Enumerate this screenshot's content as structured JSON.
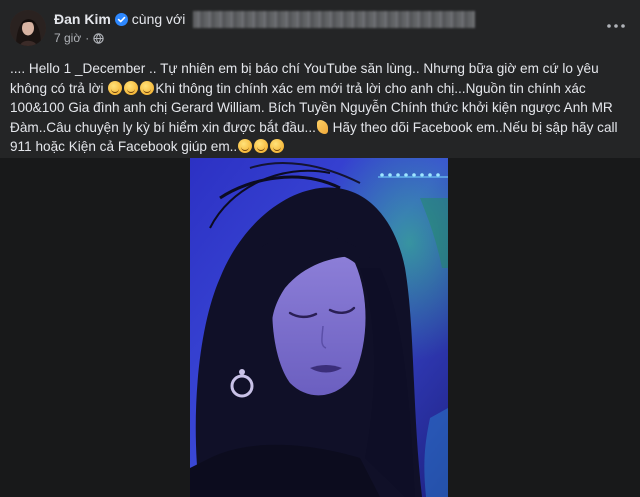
{
  "header": {
    "author": "Đan Kim",
    "with_text": "cùng với",
    "time": "7 giờ",
    "separator": "·",
    "icons": {
      "verified": "verified-badge-icon",
      "audience": "globe-icon",
      "more": "more-options-icon"
    },
    "accent_color": "#2d88ff"
  },
  "post": {
    "segments": [
      ".... Hello 1 _December .. Tự nhiên em bị báo chí YouTube săn lùng.. Nhưng bữa giờ em cứ lo yêu không có trả lời ",
      "Khi thông tin chính xác em mới trả lời cho anh chị...Nguồn tin chính xác 100&100 Gia đình anh chị Gerard William. Bích Tuyền Nguyễn Chính thức khởi kiện ngược Anh MR Đàm..Câu chuyện ly kỳ bí hiểm xin được bắt đầu...",
      "Hãy theo dõi Facebook em..Nếu bị sập hãy call 911 hoặc Kiện cả Facebook giúp em.."
    ]
  },
  "media": {
    "type": "photo",
    "icon": "woman-portrait-photo"
  },
  "colors": {
    "background": "#242526",
    "text": "#e4e6eb",
    "secondary": "#b0b3b8",
    "photo_blue": "#3a48d6"
  }
}
